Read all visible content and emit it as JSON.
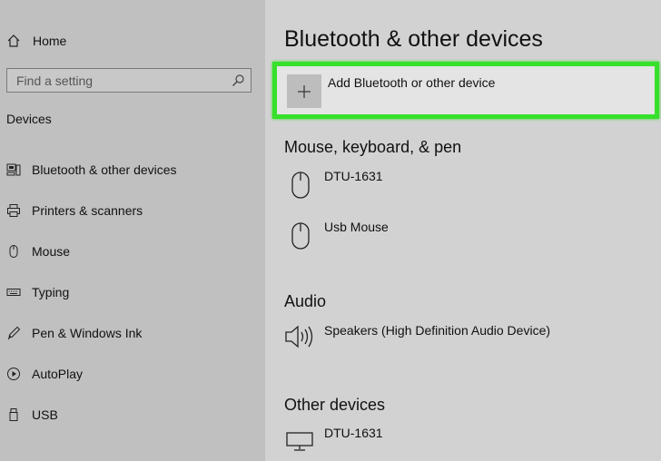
{
  "sidebar": {
    "home_label": "Home",
    "search_placeholder": "Find a setting",
    "devices_heading": "Devices",
    "items": [
      {
        "label": "Bluetooth & other devices",
        "icon": "bluetooth-devices-icon"
      },
      {
        "label": "Printers & scanners",
        "icon": "printer-icon"
      },
      {
        "label": "Mouse",
        "icon": "mouse-icon"
      },
      {
        "label": "Typing",
        "icon": "keyboard-icon"
      },
      {
        "label": "Pen & Windows Ink",
        "icon": "pen-icon"
      },
      {
        "label": "AutoPlay",
        "icon": "autoplay-icon"
      },
      {
        "label": "USB",
        "icon": "usb-icon"
      }
    ]
  },
  "main": {
    "title": "Bluetooth & other devices",
    "add_device_label": "Add Bluetooth or other device",
    "sections": {
      "mouse_keyboard_pen": {
        "heading": "Mouse, keyboard, & pen",
        "devices": [
          {
            "name": "DTU-1631",
            "icon": "mouse-icon"
          },
          {
            "name": "Usb Mouse",
            "icon": "mouse-icon"
          }
        ]
      },
      "audio": {
        "heading": "Audio",
        "devices": [
          {
            "name": "Speakers (High Definition Audio Device)",
            "icon": "speaker-icon"
          }
        ]
      },
      "other": {
        "heading": "Other devices",
        "devices": [
          {
            "name": "DTU-1631",
            "icon": "monitor-icon"
          }
        ]
      }
    }
  },
  "colors": {
    "sidebar_bg": "#c0c0c0",
    "main_bg": "#d2d2d2",
    "highlight": "#36e02b"
  }
}
